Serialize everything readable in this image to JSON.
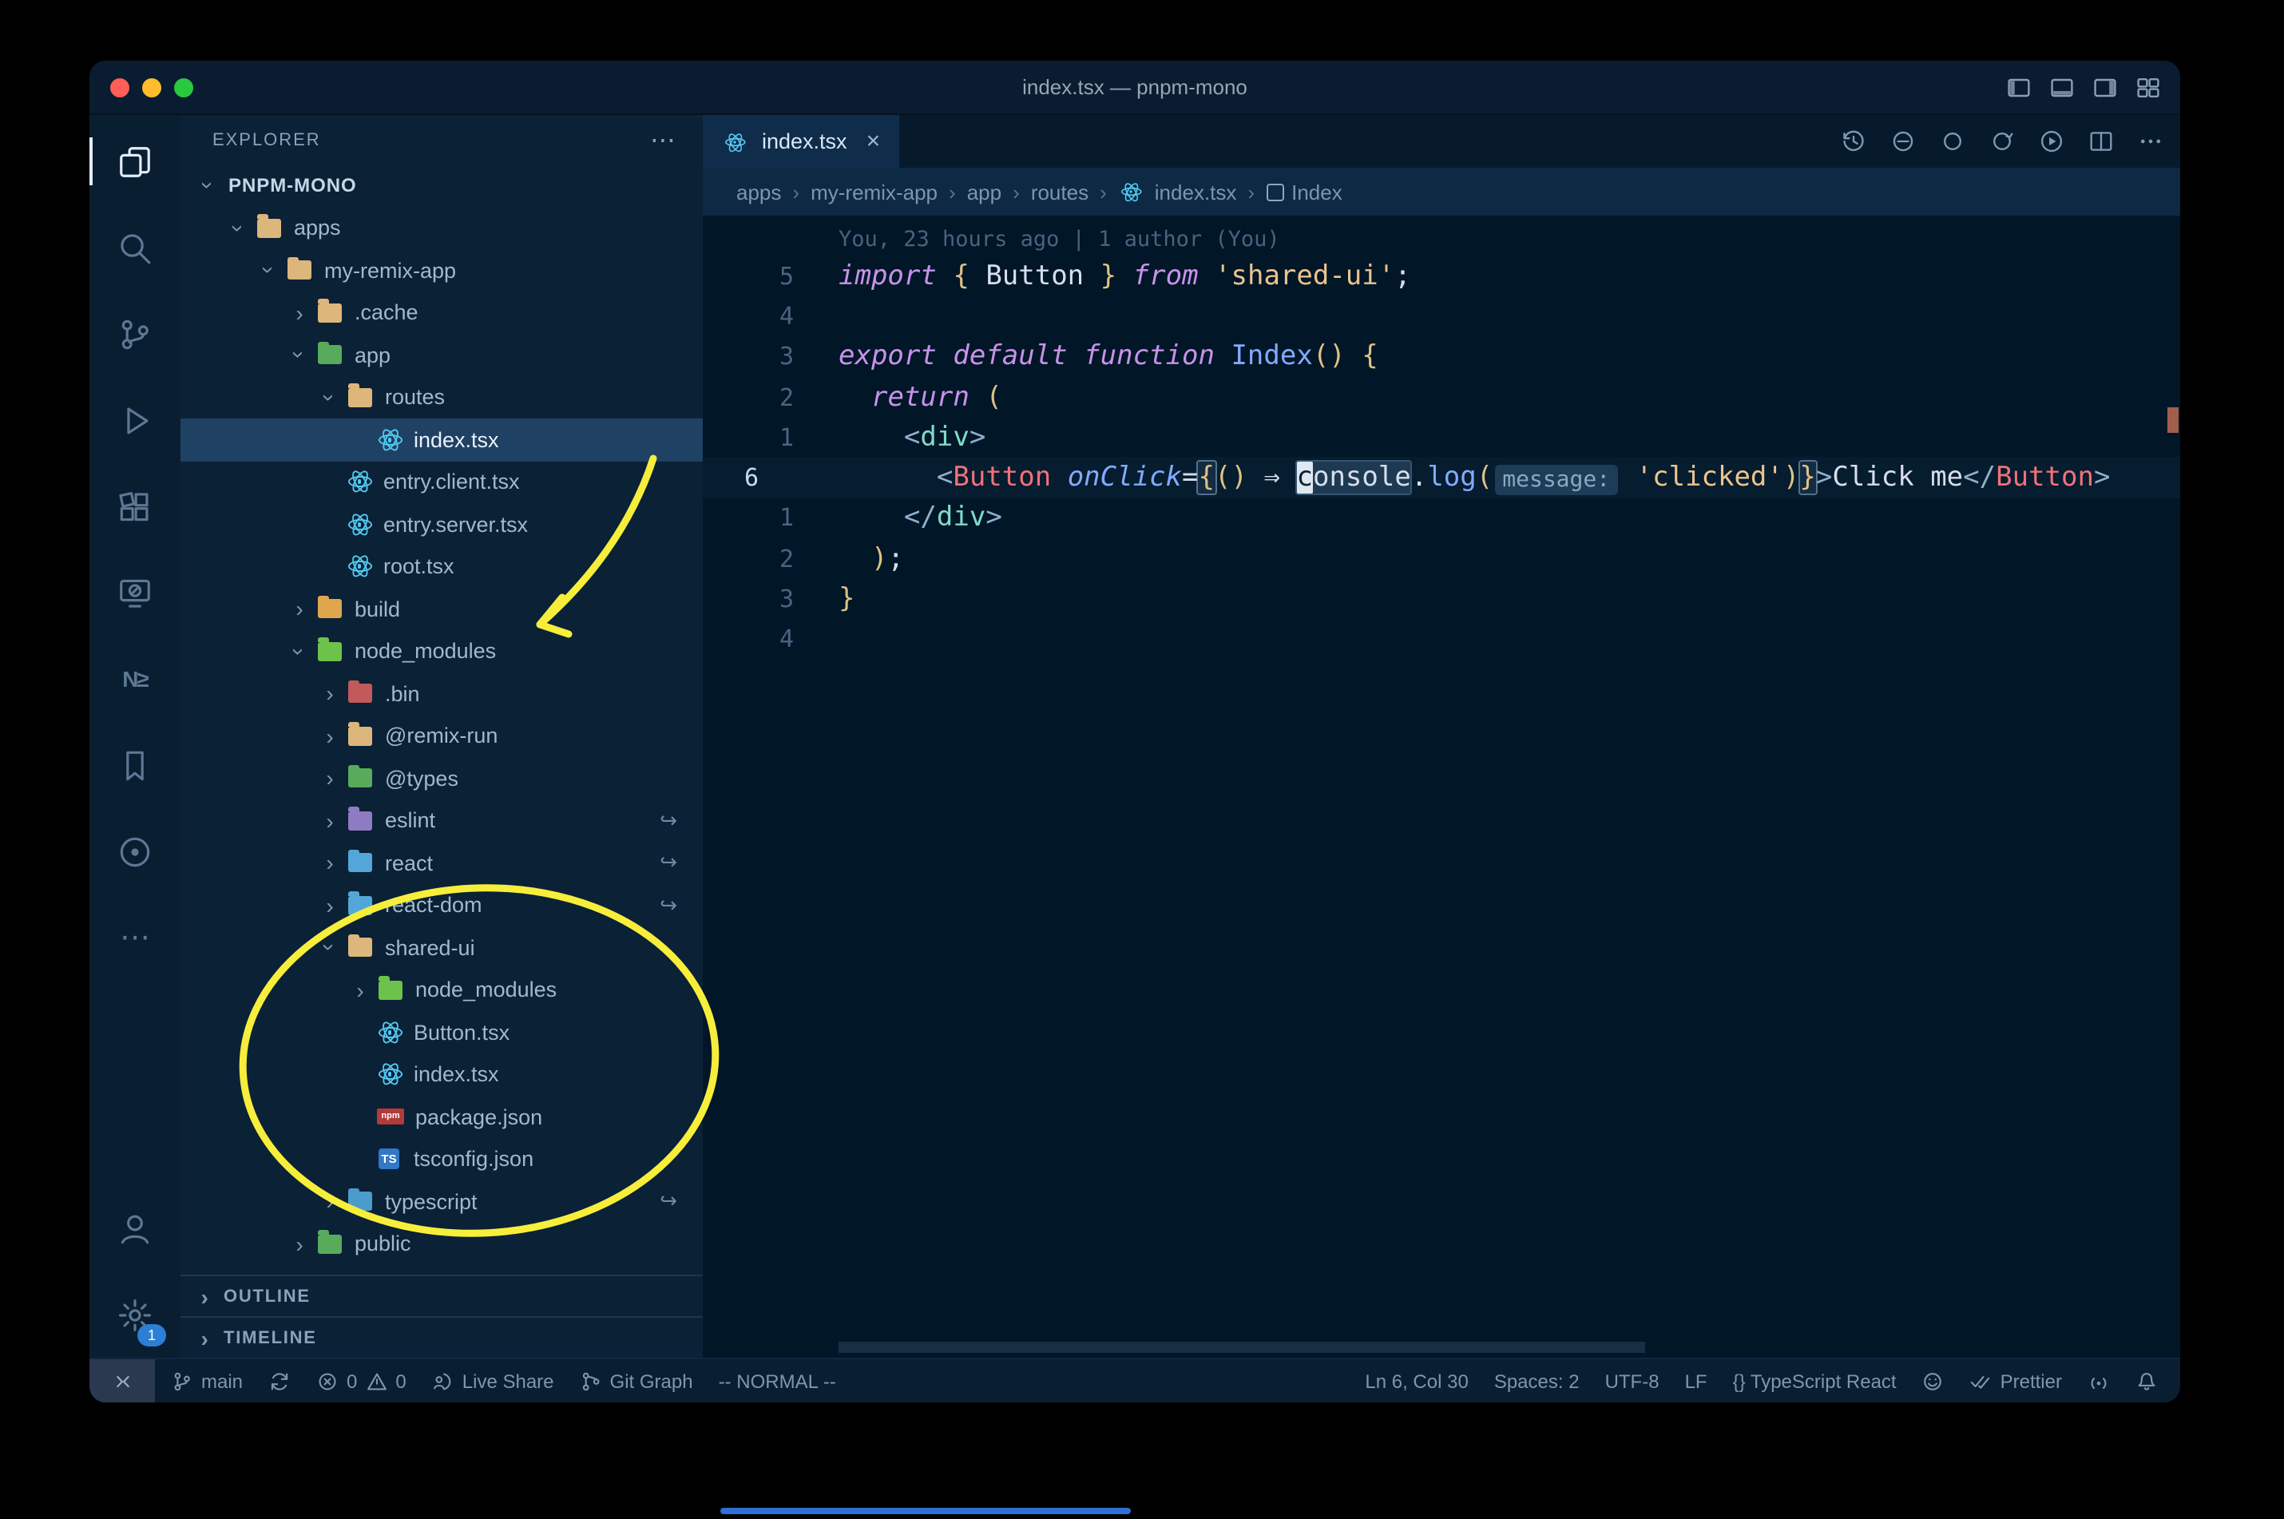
{
  "window": {
    "title": "index.tsx — pnpm-mono",
    "controls": [
      {
        "name": "close",
        "color": "#ff5f57"
      },
      {
        "name": "minimize",
        "color": "#febc2e"
      },
      {
        "name": "zoom",
        "color": "#28c840"
      }
    ],
    "layout_icons": [
      "layout-left",
      "layout-panel",
      "layout-right",
      "layout-grid"
    ]
  },
  "activity_bar": {
    "top": [
      {
        "name": "explorer",
        "active": true
      },
      {
        "name": "search"
      },
      {
        "name": "source-control"
      },
      {
        "name": "run-debug"
      },
      {
        "name": "extensions"
      },
      {
        "name": "remote-explorer"
      },
      {
        "name": "nx-console",
        "text": "N≥"
      },
      {
        "name": "bookmarks"
      },
      {
        "name": "plugin-circle"
      },
      {
        "name": "more-views",
        "text": "⋯"
      }
    ],
    "bottom": [
      {
        "name": "account"
      },
      {
        "name": "settings",
        "badge": "1"
      }
    ]
  },
  "sidebar": {
    "header": "EXPLORER",
    "more_actions": "⋯",
    "tree": [
      {
        "label": "PNPM-MONO",
        "level": 0,
        "chev": "down",
        "bold": true
      },
      {
        "label": "apps",
        "level": 1,
        "chev": "down",
        "icon": {
          "k": "folder",
          "c": "#dcb67a"
        }
      },
      {
        "label": "my-remix-app",
        "level": 2,
        "chev": "down",
        "icon": {
          "k": "folder",
          "c": "#dcb67a"
        }
      },
      {
        "label": ".cache",
        "level": 3,
        "chev": "right",
        "icon": {
          "k": "folder",
          "c": "#dcb67a"
        }
      },
      {
        "label": "app",
        "level": 3,
        "chev": "down",
        "icon": {
          "k": "folder",
          "c": "#57ab5a"
        }
      },
      {
        "label": "routes",
        "level": 4,
        "chev": "down",
        "icon": {
          "k": "folder",
          "c": "#dcb67a"
        }
      },
      {
        "label": "index.tsx",
        "level": 5,
        "chev": null,
        "icon": {
          "k": "react"
        },
        "selected": true
      },
      {
        "label": "entry.client.tsx",
        "level": 4,
        "chev": null,
        "icon": {
          "k": "react"
        }
      },
      {
        "label": "entry.server.tsx",
        "level": 4,
        "chev": null,
        "icon": {
          "k": "react"
        }
      },
      {
        "label": "root.tsx",
        "level": 4,
        "chev": null,
        "icon": {
          "k": "react"
        }
      },
      {
        "label": "build",
        "level": 3,
        "chev": "right",
        "icon": {
          "k": "folder",
          "c": "#e0a64e"
        }
      },
      {
        "label": "node_modules",
        "level": 3,
        "chev": "down",
        "icon": {
          "k": "folder",
          "c": "#6cc24a"
        }
      },
      {
        "label": ".bin",
        "level": 4,
        "chev": "right",
        "icon": {
          "k": "folder",
          "c": "#c25a5a"
        }
      },
      {
        "label": "@remix-run",
        "level": 4,
        "chev": "right",
        "icon": {
          "k": "folder",
          "c": "#dcb67a"
        }
      },
      {
        "label": "@types",
        "level": 4,
        "chev": "right",
        "icon": {
          "k": "folder",
          "c": "#57ab5a"
        }
      },
      {
        "label": "eslint",
        "level": 4,
        "chev": "right",
        "icon": {
          "k": "folder",
          "c": "#8e7cc3"
        },
        "symlink": true
      },
      {
        "label": "react",
        "level": 4,
        "chev": "right",
        "icon": {
          "k": "folder",
          "c": "#53a7d8"
        },
        "symlink": true
      },
      {
        "label": "react-dom",
        "level": 4,
        "chev": "right",
        "icon": {
          "k": "folder",
          "c": "#53a7d8"
        },
        "symlink": true
      },
      {
        "label": "shared-ui",
        "level": 4,
        "chev": "down",
        "icon": {
          "k": "folder",
          "c": "#dcb67a"
        }
      },
      {
        "label": "node_modules",
        "level": 5,
        "chev": "right",
        "icon": {
          "k": "folder",
          "c": "#6cc24a"
        }
      },
      {
        "label": "Button.tsx",
        "level": 5,
        "chev": null,
        "icon": {
          "k": "react"
        }
      },
      {
        "label": "index.tsx",
        "level": 5,
        "chev": null,
        "icon": {
          "k": "react"
        }
      },
      {
        "label": "package.json",
        "level": 5,
        "chev": null,
        "icon": {
          "k": "npm"
        }
      },
      {
        "label": "tsconfig.json",
        "level": 5,
        "chev": null,
        "icon": {
          "k": "ts"
        }
      },
      {
        "label": "typescript",
        "level": 4,
        "chev": "right",
        "icon": {
          "k": "folder",
          "c": "#4a9ccd"
        },
        "symlink": true
      },
      {
        "label": "public",
        "level": 3,
        "chev": "right",
        "icon": {
          "k": "folder",
          "c": "#57ab5a"
        }
      }
    ],
    "sections": [
      {
        "label": "OUTLINE"
      },
      {
        "label": "TIMELINE"
      }
    ]
  },
  "editor": {
    "tab": {
      "label": "index.tsx",
      "icon": "react",
      "close": "×"
    },
    "actions": [
      {
        "name": "history"
      },
      {
        "name": "compare"
      },
      {
        "name": "ring"
      },
      {
        "name": "ring-arrow"
      },
      {
        "name": "run"
      },
      {
        "name": "split"
      },
      {
        "name": "more-dots"
      }
    ],
    "breadcrumbs": [
      {
        "label": "apps"
      },
      {
        "label": "my-remix-app"
      },
      {
        "label": "app"
      },
      {
        "label": "routes"
      },
      {
        "label": "index.tsx",
        "icon": "react"
      },
      {
        "label": "Index",
        "icon": "symbol"
      }
    ],
    "blame": "You, 23 hours ago | 1 author (You)",
    "lines": [
      {
        "num": "5",
        "tokens": [
          {
            "t": "import",
            "c": "k"
          },
          {
            "t": " ",
            "c": "t"
          },
          {
            "t": "{",
            "c": "g"
          },
          {
            "t": " Button ",
            "c": "t"
          },
          {
            "t": "}",
            "c": "g"
          },
          {
            "t": " ",
            "c": "t"
          },
          {
            "t": "from",
            "c": "k"
          },
          {
            "t": " ",
            "c": "t"
          },
          {
            "t": "'shared-ui'",
            "c": "s"
          },
          {
            "t": ";",
            "c": "t"
          }
        ]
      },
      {
        "num": "4",
        "tokens": []
      },
      {
        "num": "3",
        "tokens": [
          {
            "t": "export",
            "c": "k"
          },
          {
            "t": " ",
            "c": "t"
          },
          {
            "t": "default",
            "c": "k"
          },
          {
            "t": " ",
            "c": "t"
          },
          {
            "t": "function",
            "c": "k"
          },
          {
            "t": " ",
            "c": "t"
          },
          {
            "t": "Index",
            "c": "f"
          },
          {
            "t": "()",
            "c": "g"
          },
          {
            "t": " ",
            "c": "t"
          },
          {
            "t": "{",
            "c": "g"
          }
        ]
      },
      {
        "num": "2",
        "tokens": [
          {
            "t": "  ",
            "c": "t"
          },
          {
            "t": "return",
            "c": "k"
          },
          {
            "t": " ",
            "c": "t"
          },
          {
            "t": "(",
            "c": "g"
          }
        ]
      },
      {
        "num": "1",
        "tokens": [
          {
            "t": "    ",
            "c": "t"
          },
          {
            "t": "<",
            "c": "pb"
          },
          {
            "t": "div",
            "c": "tg"
          },
          {
            "t": ">",
            "c": "pb"
          }
        ]
      },
      {
        "num": "6",
        "active": true,
        "tokens": [
          {
            "t": "      ",
            "c": "t"
          },
          {
            "t": "<",
            "c": "pb"
          },
          {
            "t": "Button",
            "c": "cp"
          },
          {
            "t": " ",
            "c": "t"
          },
          {
            "t": "onClick",
            "c": "at"
          },
          {
            "t": "=",
            "c": "t"
          },
          {
            "t": "{",
            "c": "g bm"
          },
          {
            "t": "()",
            "c": "g"
          },
          {
            "t": " ",
            "c": "t"
          },
          {
            "t": "⇒",
            "c": "ar"
          },
          {
            "t": " ",
            "c": "t"
          },
          {
            "t": "console",
            "c": "t wh cfirst",
            "n": "cursor-word"
          },
          {
            "t": ".",
            "c": "t"
          },
          {
            "t": "log",
            "c": "f"
          },
          {
            "t": "(",
            "c": "g"
          },
          {
            "t": "message:",
            "c": "in",
            "n": "inlay-hint"
          },
          {
            "t": " ",
            "c": "t"
          },
          {
            "t": "'clicked'",
            "c": "s"
          },
          {
            "t": ")",
            "c": "g"
          },
          {
            "t": "}",
            "c": "g bm"
          },
          {
            "t": ">",
            "c": "pb"
          },
          {
            "t": "Click me",
            "c": "t"
          },
          {
            "t": "</",
            "c": "pb"
          },
          {
            "t": "Button",
            "c": "cp"
          },
          {
            "t": ">",
            "c": "pb"
          }
        ]
      },
      {
        "num": "1",
        "tokens": [
          {
            "t": "    ",
            "c": "t"
          },
          {
            "t": "</",
            "c": "pb"
          },
          {
            "t": "div",
            "c": "tg"
          },
          {
            "t": ">",
            "c": "pb"
          }
        ]
      },
      {
        "num": "2",
        "tokens": [
          {
            "t": "  ",
            "c": "t"
          },
          {
            "t": ")",
            "c": "g"
          },
          {
            "t": ";",
            "c": "t"
          }
        ]
      },
      {
        "num": "3",
        "tokens": [
          {
            "t": "}",
            "c": "g"
          }
        ]
      },
      {
        "num": "4",
        "tokens": []
      }
    ]
  },
  "status_bar": {
    "left": [
      {
        "name": "remote-indicator",
        "cls": "remote-box",
        "segs": [
          {
            "ic": "remote"
          }
        ]
      },
      {
        "name": "git-branch",
        "segs": [
          {
            "ic": "branch"
          },
          {
            "tx": "main"
          }
        ]
      },
      {
        "name": "sync-changes",
        "segs": [
          {
            "ic": "sync"
          }
        ]
      },
      {
        "name": "problems",
        "segs": [
          {
            "ic": "error"
          },
          {
            "tx": "0"
          },
          {
            "ic": "warning"
          },
          {
            "tx": "0"
          }
        ]
      },
      {
        "name": "live-share",
        "segs": [
          {
            "ic": "liveshare"
          },
          {
            "tx": "Live Share"
          }
        ]
      },
      {
        "name": "git-graph",
        "segs": [
          {
            "ic": "gitgraph"
          },
          {
            "tx": "Git Graph"
          }
        ]
      },
      {
        "name": "vim-mode",
        "segs": [
          {
            "tx": "-- NORMAL --"
          }
        ]
      }
    ],
    "right": [
      {
        "name": "cursor-position",
        "segs": [
          {
            "tx": "Ln 6, Col 30"
          }
        ]
      },
      {
        "name": "indentation",
        "segs": [
          {
            "tx": "Spaces: 2"
          }
        ]
      },
      {
        "name": "encoding",
        "segs": [
          {
            "tx": "UTF-8"
          }
        ]
      },
      {
        "name": "eol-sequence",
        "segs": [
          {
            "tx": "LF"
          }
        ]
      },
      {
        "name": "language-mode",
        "segs": [
          {
            "tx": "{} TypeScript React"
          }
        ]
      },
      {
        "name": "feedback-smiley",
        "segs": [
          {
            "ic": "smiley"
          }
        ]
      },
      {
        "name": "prettier",
        "segs": [
          {
            "ic": "checkdouble"
          },
          {
            "tx": "Prettier"
          }
        ]
      },
      {
        "name": "broadcast",
        "segs": [
          {
            "ic": "broadcast"
          }
        ]
      },
      {
        "name": "notifications",
        "segs": [
          {
            "ic": "bell"
          }
        ]
      }
    ]
  },
  "annotations": {
    "color": "#f6ee3b",
    "items": [
      "hand-drawn arrow pointing to node_modules",
      "hand-drawn ellipse around shared-ui contents"
    ]
  },
  "colors": {
    "editor_background": "#011627",
    "sidebar_background": "#0b2136",
    "selection_background": "#1f4163",
    "react_icon_blue": "#53c9f1",
    "accent_blue_line": "#2f6fd6",
    "settings_badge_blue": "#2b7fd4"
  }
}
